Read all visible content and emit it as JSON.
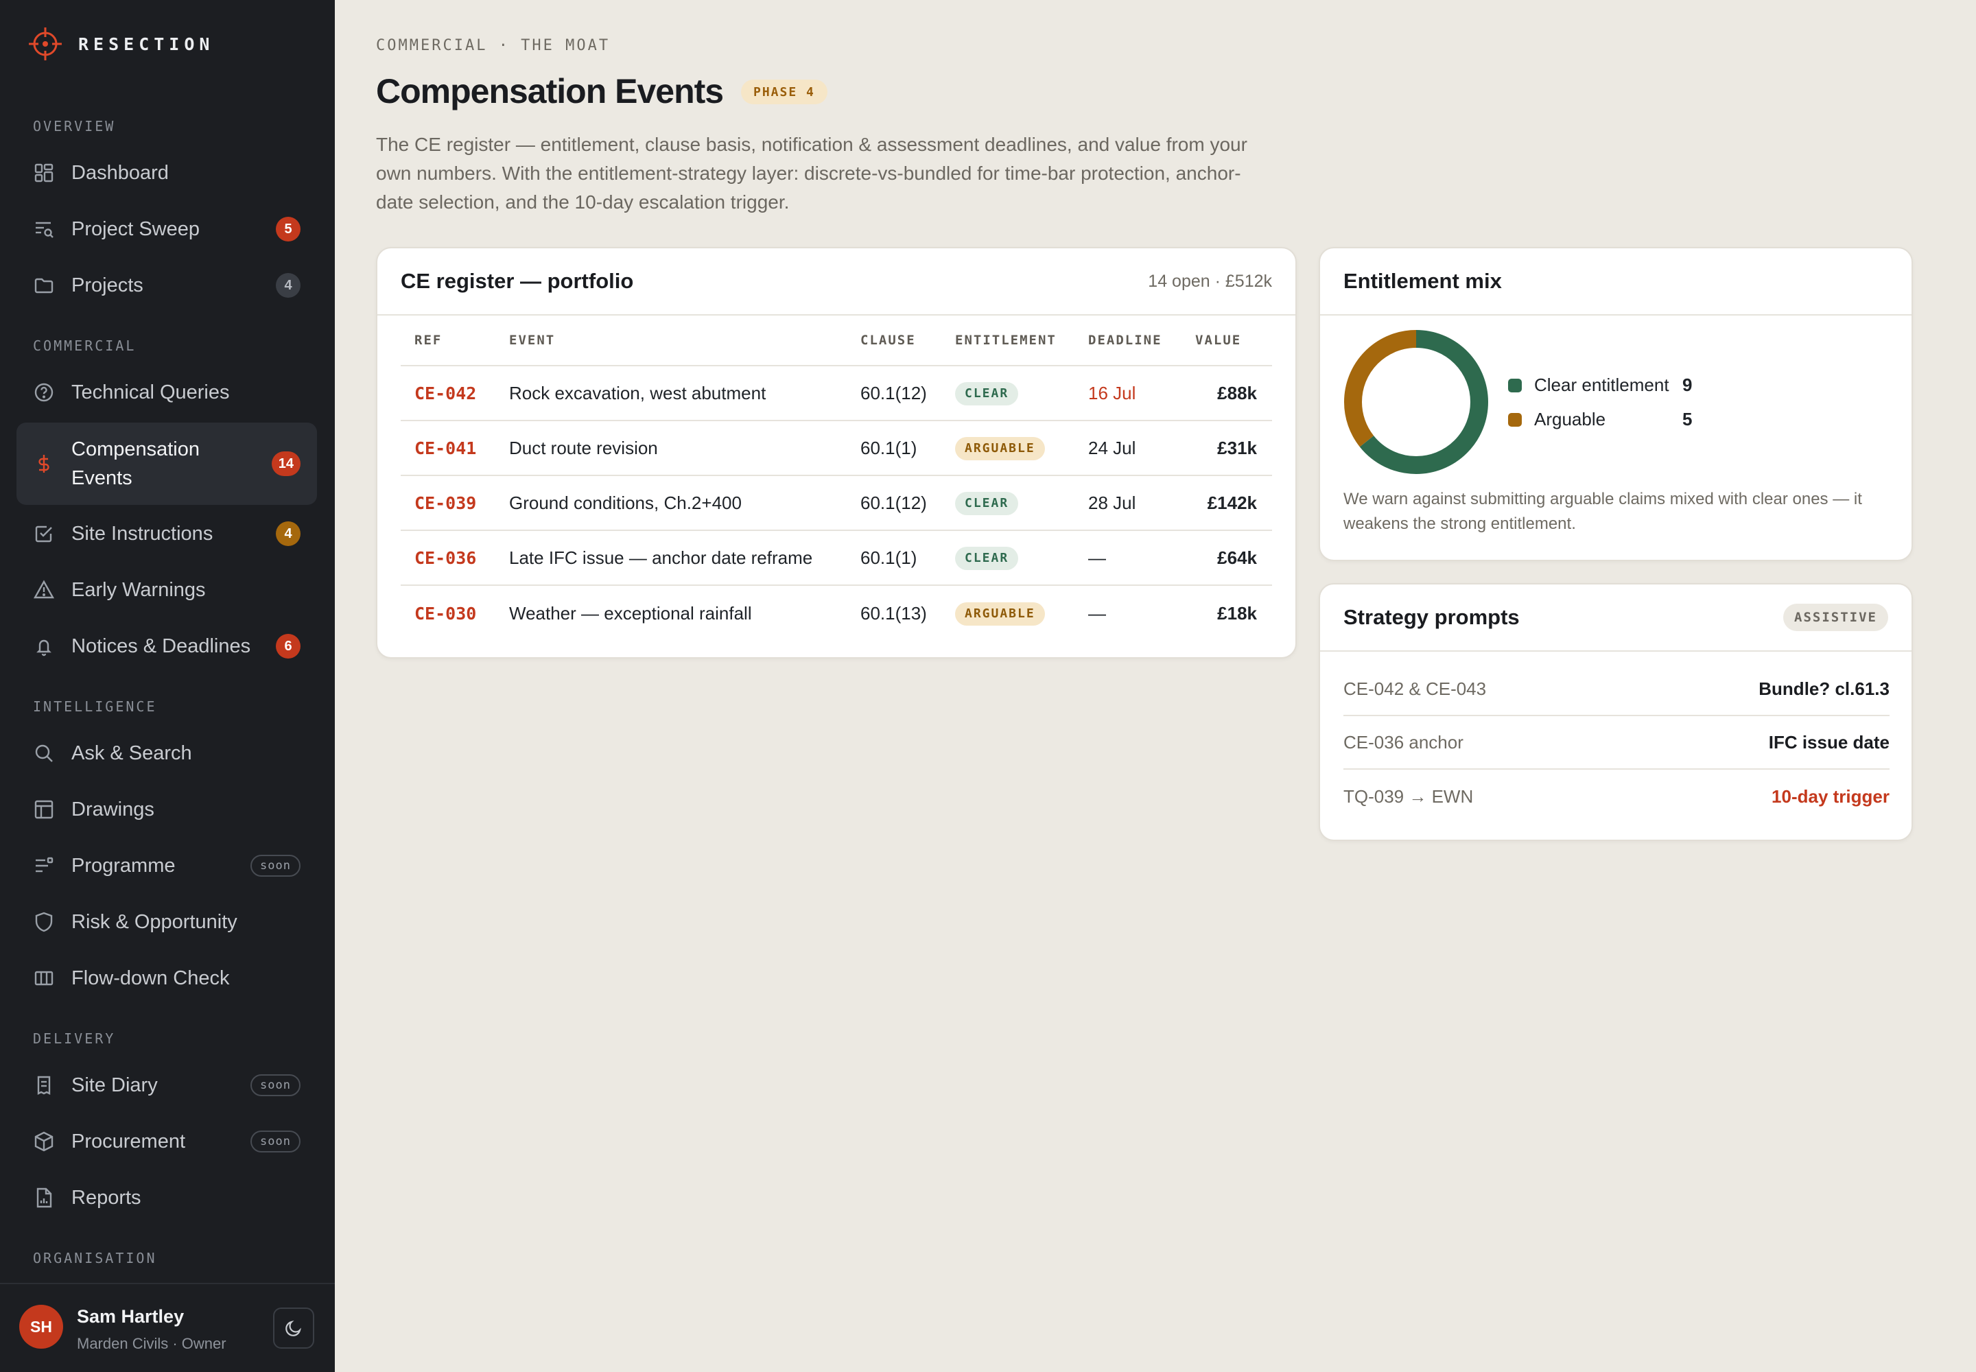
{
  "brand": {
    "name": "RESECTION"
  },
  "sidebar": {
    "sections": {
      "overview": "OVERVIEW",
      "commercial": "COMMERCIAL",
      "intelligence": "INTELLIGENCE",
      "delivery": "DELIVERY",
      "organisation": "ORGANISATION"
    },
    "items": [
      {
        "label": "Dashboard",
        "icon": "dashboard-icon"
      },
      {
        "label": "Project Sweep",
        "icon": "sweep-icon",
        "badge": "5"
      },
      {
        "label": "Projects",
        "icon": "folder-icon",
        "badge": "4"
      },
      {
        "label": "Technical Queries",
        "icon": "question-icon"
      },
      {
        "label": "Compensation Events",
        "icon": "dollar-icon",
        "badge": "14"
      },
      {
        "label": "Site Instructions",
        "icon": "checkbox-icon",
        "badge": "4"
      },
      {
        "label": "Early Warnings",
        "icon": "warning-icon"
      },
      {
        "label": "Notices & Deadlines",
        "icon": "bell-icon",
        "badge": "6"
      },
      {
        "label": "Ask & Search",
        "icon": "search-icon"
      },
      {
        "label": "Drawings",
        "icon": "layout-icon"
      },
      {
        "label": "Programme",
        "icon": "programme-icon",
        "badge": "soon"
      },
      {
        "label": "Risk & Opportunity",
        "icon": "shield-icon"
      },
      {
        "label": "Flow-down Check",
        "icon": "columns-icon"
      },
      {
        "label": "Site Diary",
        "icon": "diary-icon",
        "badge": "soon"
      },
      {
        "label": "Procurement",
        "icon": "box-icon",
        "badge": "soon"
      },
      {
        "label": "Reports",
        "icon": "report-icon"
      }
    ]
  },
  "user": {
    "initials": "SH",
    "name": "Sam Hartley",
    "subtitle": "Marden Civils · Owner"
  },
  "header": {
    "breadcrumb": "COMMERCIAL · THE MOAT",
    "title": "Compensation Events",
    "phase": "PHASE 4",
    "intro": "The CE register — entitlement, clause basis, notification & assessment deadlines, and value from your own numbers. With the entitlement-strategy layer: discrete-vs-bundled for time-bar protection, anchor-date selection, and the 10-day escalation trigger."
  },
  "register": {
    "title": "CE register — portfolio",
    "meta": "14 open · £512k",
    "columns": [
      "REF",
      "EVENT",
      "CLAUSE",
      "ENTITLEMENT",
      "DEADLINE",
      "VALUE"
    ],
    "rows": [
      {
        "ref": "CE-042",
        "event": "Rock excavation, west abutment",
        "clause": "60.1(12)",
        "entitlement": "CLEAR",
        "deadline": "16 Jul",
        "value": "£88k"
      },
      {
        "ref": "CE-041",
        "event": "Duct route revision",
        "clause": "60.1(1)",
        "entitlement": "ARGUABLE",
        "deadline": "24 Jul",
        "value": "£31k"
      },
      {
        "ref": "CE-039",
        "event": "Ground conditions, Ch.2+400",
        "clause": "60.1(12)",
        "entitlement": "CLEAR",
        "deadline": "28 Jul",
        "value": "£142k"
      },
      {
        "ref": "CE-036",
        "event": "Late IFC issue — anchor date reframe",
        "clause": "60.1(1)",
        "entitlement": "CLEAR",
        "deadline": "—",
        "value": "£64k"
      },
      {
        "ref": "CE-030",
        "event": "Weather — exceptional rainfall",
        "clause": "60.1(13)",
        "entitlement": "ARGUABLE",
        "deadline": "—",
        "value": "£18k"
      }
    ]
  },
  "mix": {
    "title": "Entitlement mix",
    "note": "We warn against submitting arguable claims mixed with clear ones — it weakens the strong entitlement."
  },
  "strategy": {
    "title": "Strategy prompts",
    "tag": "ASSISTIVE",
    "rows": [
      {
        "label": "CE-042 & CE-043",
        "value": "Bundle? cl.61.3"
      },
      {
        "label": "CE-036 anchor",
        "value": "IFC issue date"
      },
      {
        "label": "TQ-039 → EWN",
        "value": "10-day trigger"
      }
    ]
  },
  "colors": {
    "accent": "#C4391D",
    "clear": "#2E6A4E",
    "arguable": "#A5680D",
    "sidebar_bg": "#1C1E22",
    "page_bg": "#ECE9E2"
  },
  "chart_data": {
    "type": "pie",
    "categories": [
      "Clear entitlement",
      "Arguable"
    ],
    "values": [
      9,
      5
    ]
  }
}
